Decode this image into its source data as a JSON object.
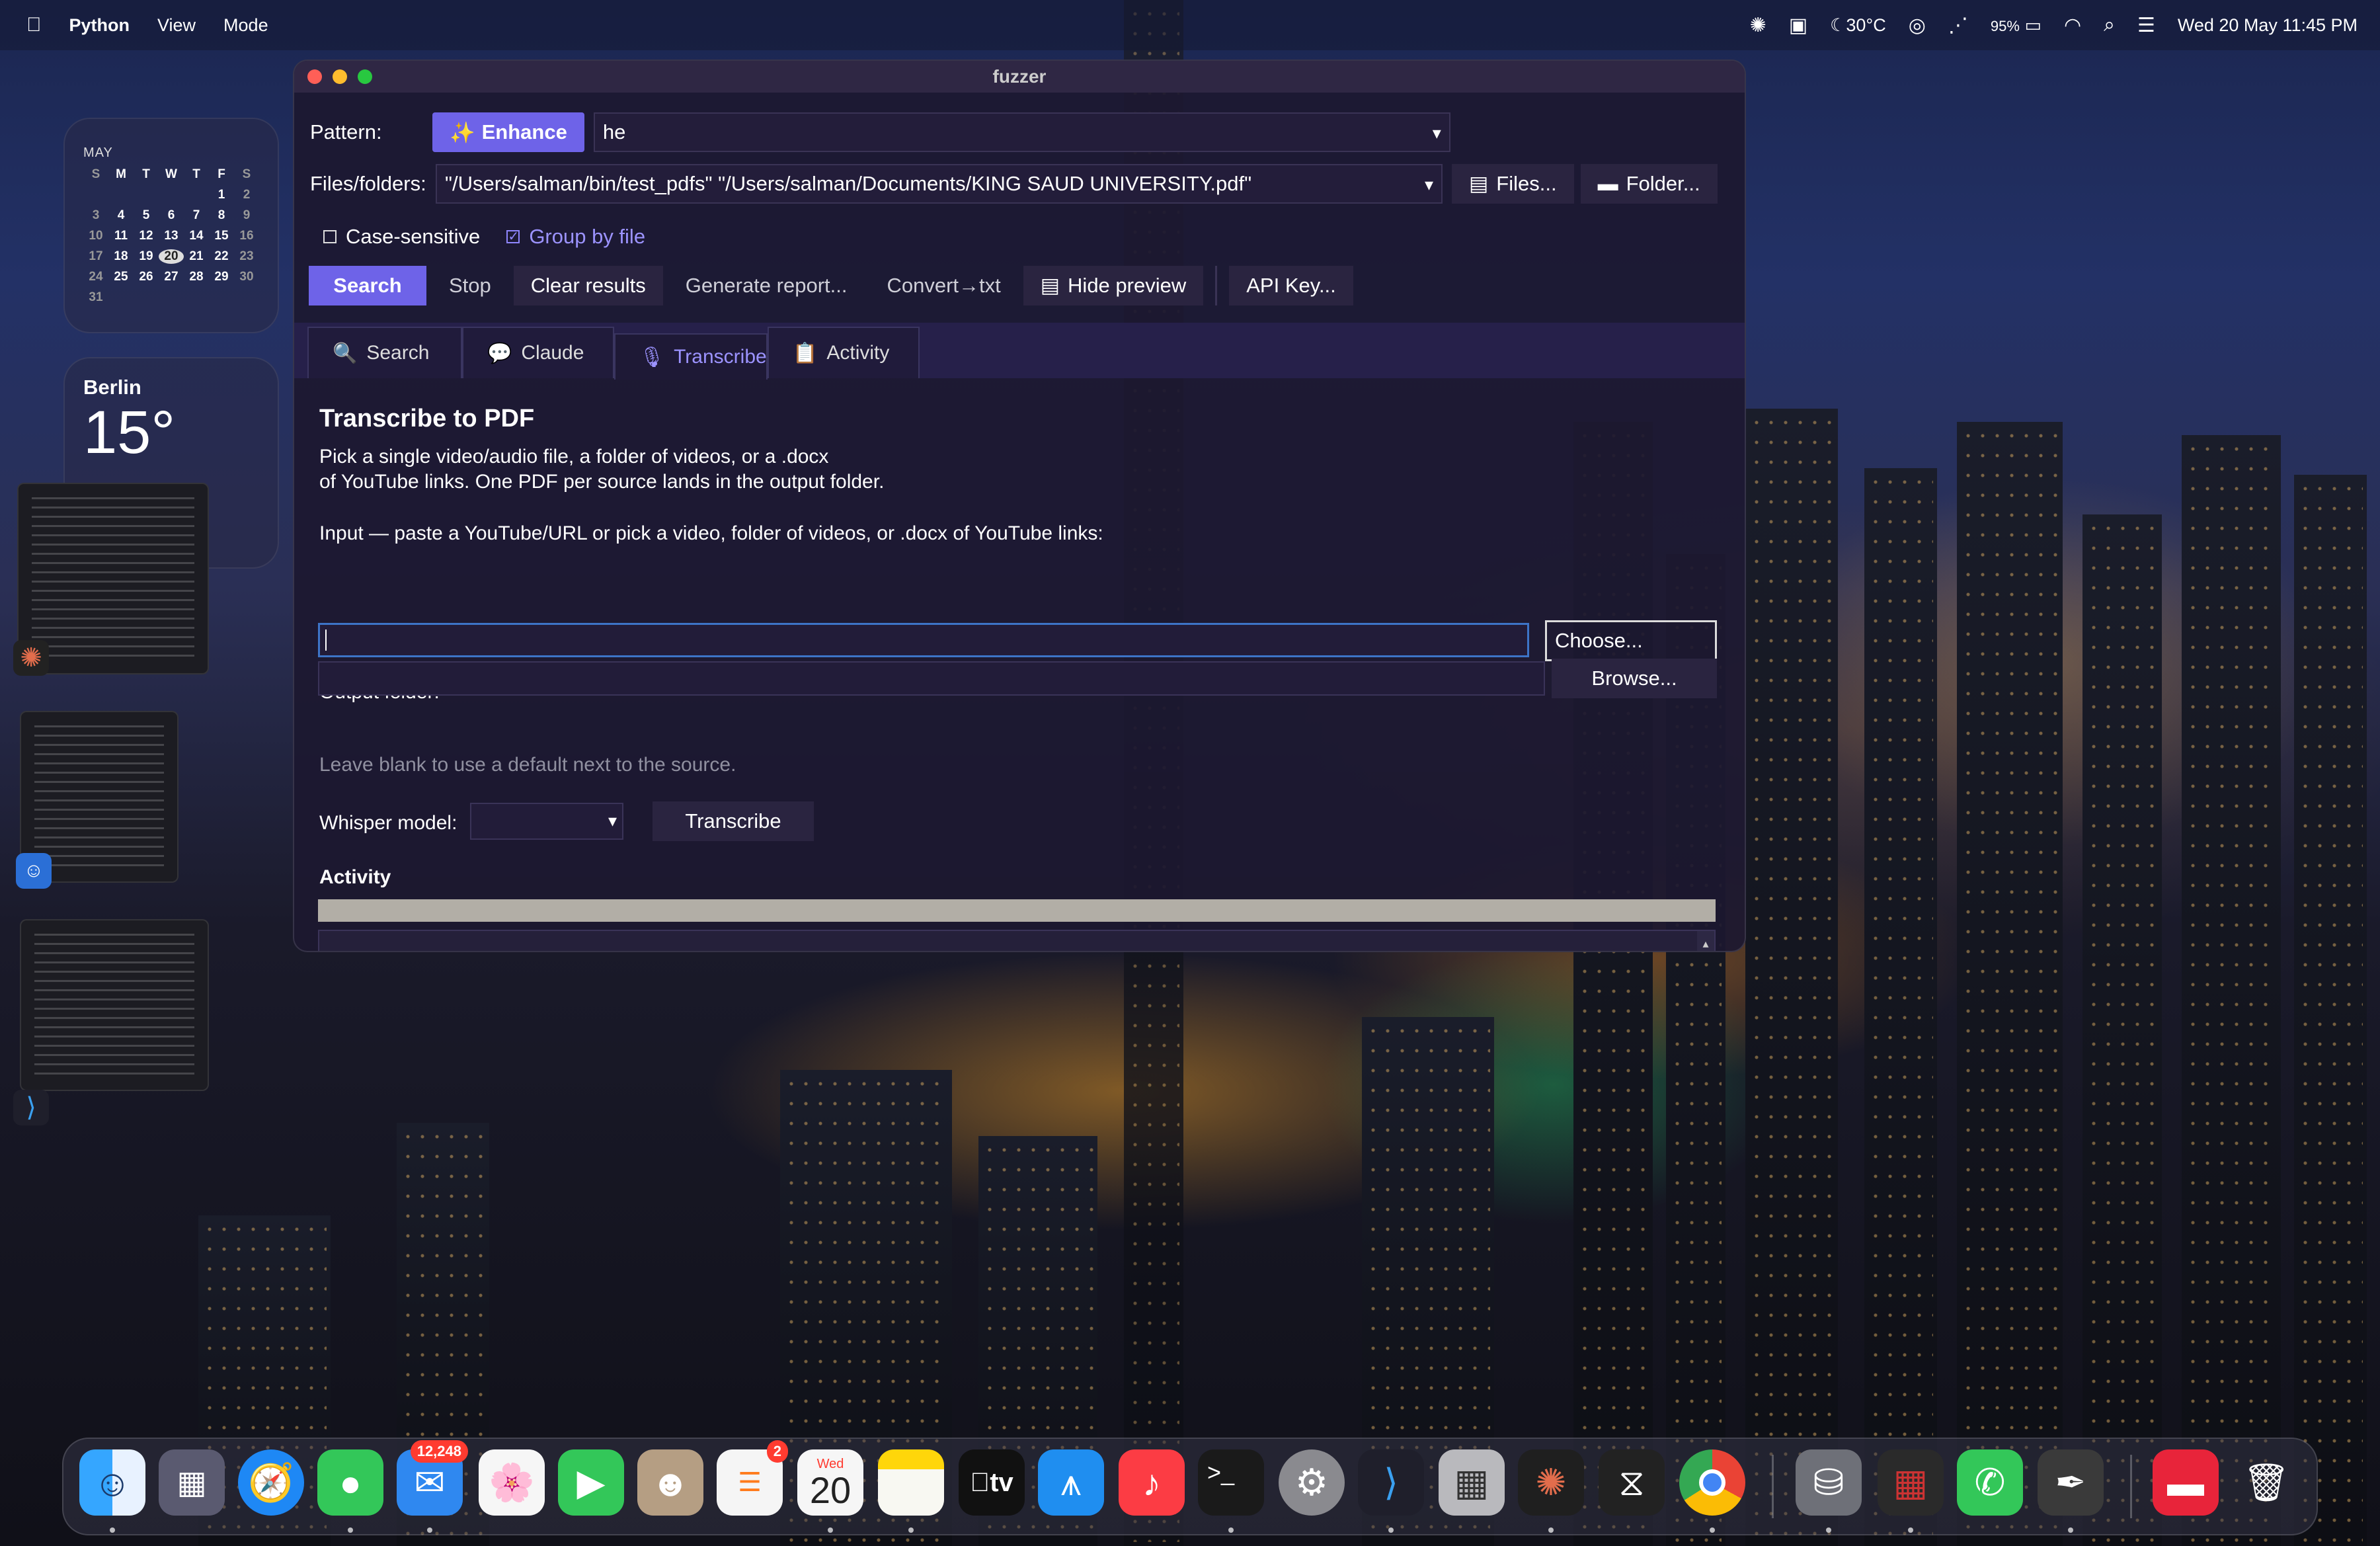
{
  "menubar": {
    "app": "Python",
    "menus": [
      "View",
      "Mode"
    ],
    "temperature": "30°C",
    "battery": "95%",
    "datetime": "Wed 20 May  11:45 PM"
  },
  "calendar": {
    "month": "MAY",
    "weekdays": [
      "S",
      "M",
      "T",
      "W",
      "T",
      "F",
      "S"
    ],
    "days": [
      "",
      "",
      "",
      "",
      "",
      "1",
      "2",
      "3",
      "4",
      "5",
      "6",
      "7",
      "8",
      "9",
      "10",
      "11",
      "12",
      "13",
      "14",
      "15",
      "16",
      "17",
      "18",
      "19",
      "20",
      "21",
      "22",
      "23",
      "24",
      "25",
      "26",
      "27",
      "28",
      "29",
      "30",
      "31"
    ],
    "today": "20"
  },
  "weather": {
    "city": "Berlin",
    "temp": "15°"
  },
  "window": {
    "title": "fuzzer",
    "pattern_label": "Pattern:",
    "enhance_label": "Enhance",
    "pattern_value": "he",
    "files_label": "Files/folders:",
    "files_value": "\"/Users/salman/bin/test_pdfs\" \"/Users/salman/Documents/KING SAUD UNIVERSITY.pdf\"",
    "files_button": "Files...",
    "folder_button": "Folder...",
    "case_sensitive": "Case-sensitive",
    "group_by_file": "Group by file",
    "toolbar": {
      "search": "Search",
      "stop": "Stop",
      "clear": "Clear results",
      "report": "Generate report...",
      "convert": "Convert→txt",
      "hide_preview": "Hide preview",
      "api_key": "API Key..."
    },
    "tabs": [
      {
        "label": "Search"
      },
      {
        "label": "Claude"
      },
      {
        "label": "Transcribe"
      },
      {
        "label": "Activity"
      }
    ],
    "transcribe": {
      "heading": "Transcribe to PDF",
      "desc1": "Pick a single video/audio file, a folder of videos, or a .docx",
      "desc2": "of YouTube links. One PDF per source lands in the output folder.",
      "input_label": "Input — paste a YouTube/URL or pick a video, folder of videos, or .docx of YouTube links:",
      "input_value": "",
      "choose": "Choose...",
      "output_label": "Output folder:",
      "browse": "Browse...",
      "output_hint": "Leave blank to use a default next to the source.",
      "whisper_label": "Whisper model:",
      "whisper_value": "",
      "transcribe_button": "Transcribe",
      "activity_heading": "Activity"
    }
  },
  "dock": {
    "mail_badge": "12,248",
    "reminders_badge": "2",
    "calendar_weekday": "Wed",
    "calendar_day": "20",
    "tv_label": "tv"
  }
}
